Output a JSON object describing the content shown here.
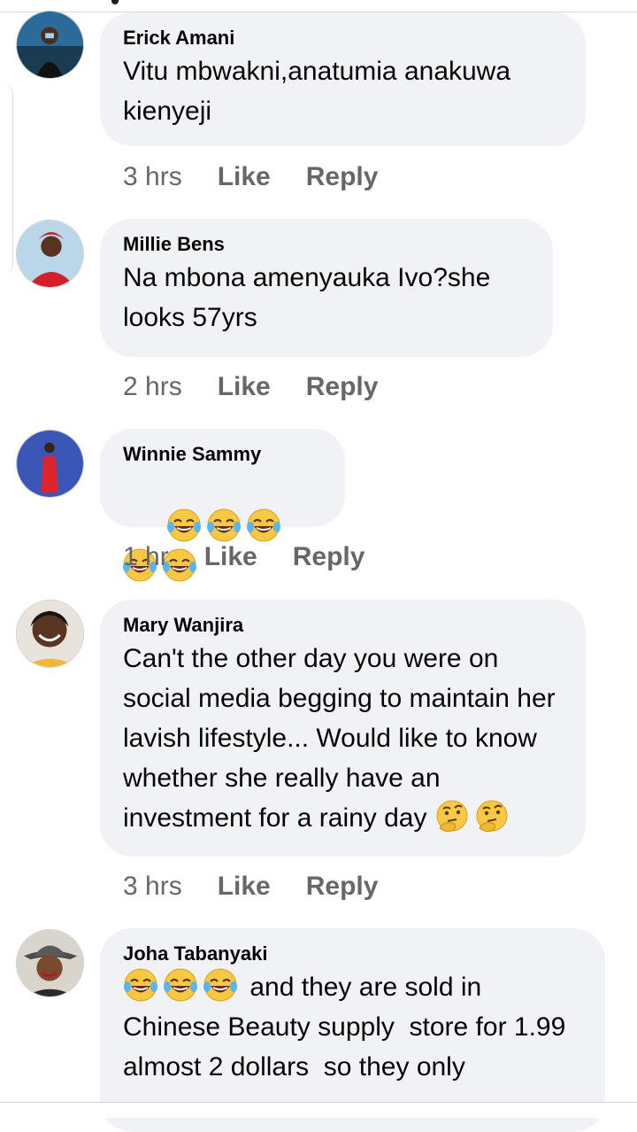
{
  "comments": [
    {
      "author": "Erick Amani",
      "text": "Vitu mbwakni,anatumia anakuwa kienyeji",
      "time": "3 hrs",
      "like": "Like",
      "reply": "Reply"
    },
    {
      "author": "Millie Bens",
      "text": "Na mbona amenyauka Ivo?she looks 57yrs",
      "time": "2 hrs",
      "like": "Like",
      "reply": "Reply"
    },
    {
      "author": "Winnie Sammy",
      "emoji": [
        "laughing-tears",
        "laughing-tears",
        "laughing-tears",
        "laughing-tears",
        "laughing-tears"
      ],
      "time": "1 hr",
      "like": "Like",
      "reply": "Reply"
    },
    {
      "author": "Mary Wanjira",
      "text": "Can't the other day you were on social media begging to maintain her lavish lifestyle... Would like to know whether she really have an investment for a rainy day",
      "trailing_emoji": [
        "thinking-face",
        "thinking-face"
      ],
      "time": "3 hrs",
      "like": "Like",
      "reply": "Reply"
    },
    {
      "author": "Joha Tabanyaki",
      "leading_emoji": [
        "laughing-tears",
        "laughing-tears",
        "laughing-tears"
      ],
      "text_line1": "and they are sold in",
      "text_rest": "Chinese Beauty supply  store for 1.99  almost 2 dollars  so they only"
    }
  ],
  "colors": {
    "bubble": "#f0f2f5",
    "meta": "#65676b",
    "text": "#050505"
  }
}
